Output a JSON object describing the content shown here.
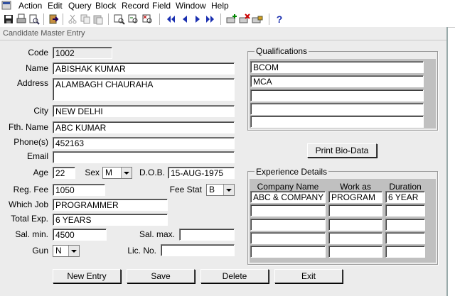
{
  "menu": [
    "Action",
    "Edit",
    "Query",
    "Block",
    "Record",
    "Field",
    "Window",
    "Help"
  ],
  "window_title": "Candidate Master Entry",
  "labels": {
    "code": "Code",
    "name": "Name",
    "address": "Address",
    "city": "City",
    "fth_name": "Fth. Name",
    "phones": "Phone(s)",
    "email": "Email",
    "age": "Age",
    "sex": "Sex",
    "dob": "D.O.B.",
    "reg_fee": "Reg. Fee",
    "fee_stat": "Fee Stat",
    "which_job": "Which Job",
    "total_exp": "Total Exp.",
    "sal_min": "Sal. min.",
    "sal_max": "Sal. max.",
    "gun": "Gun",
    "lic_no": "Lic. No."
  },
  "values": {
    "code": "1002",
    "name": "ABISHAK KUMAR",
    "address": "ALAMBAGH CHAURAHA",
    "city": "NEW DELHI",
    "fth_name": "ABC KUMAR",
    "phones": "452163",
    "email": "",
    "age": "22",
    "sex": "M",
    "dob": "15-AUG-1975",
    "reg_fee": "1050",
    "fee_stat": "B",
    "which_job": "PROGRAMMER",
    "total_exp": "6 YEARS",
    "sal_min": "4500",
    "sal_max": "",
    "gun": "N",
    "lic_no": ""
  },
  "qualifications": {
    "title": "Qualifications",
    "items": [
      "BCOM",
      "MCA",
      "",
      "",
      ""
    ]
  },
  "print_button": "Print Bio-Data",
  "experience": {
    "title": "Experience Details",
    "headers": [
      "Company Name",
      "Work as",
      "Duration"
    ],
    "rows": [
      [
        "ABC & COMPANY",
        "PROGRAM",
        "6 YEAR"
      ],
      [
        "",
        "",
        ""
      ],
      [
        "",
        "",
        ""
      ],
      [
        "",
        "",
        ""
      ],
      [
        "",
        "",
        ""
      ]
    ]
  },
  "buttons": {
    "new_entry": "New Entry",
    "save": "Save",
    "delete": "Delete",
    "exit": "Exit"
  },
  "icons": [
    "save-icon",
    "print-icon",
    "print-preview-icon",
    "exit-icon",
    "cut-icon",
    "copy-icon",
    "paste-icon",
    "query-icon",
    "execute-query-icon",
    "cancel-query-icon",
    "first-record-icon",
    "previous-record-icon",
    "next-record-icon",
    "last-record-icon",
    "insert-record-icon",
    "delete-record-icon",
    "lock-record-icon",
    "help-icon"
  ]
}
